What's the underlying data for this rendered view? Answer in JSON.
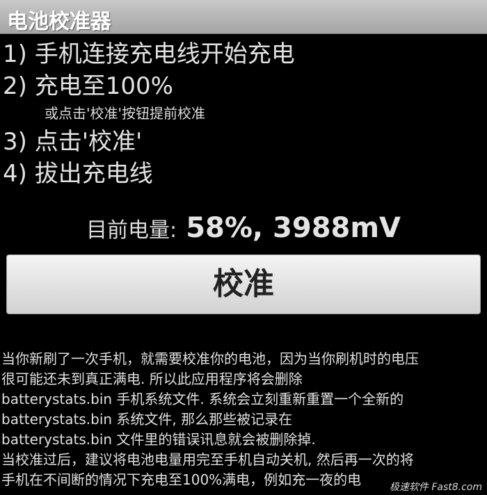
{
  "app": {
    "title": "电池校准器"
  },
  "steps": {
    "step1": "1) 手机连接充电线开始充电",
    "step2": "2) 充电至100%",
    "step2_note": "或点击'校准'按钮提前校准",
    "step3": "3) 点击'校准'",
    "step4": "4) 拔出充电线"
  },
  "battery": {
    "label": "目前电量:",
    "value": "58%, 3988mV"
  },
  "actions": {
    "calibrate_label": "校准"
  },
  "description": {
    "lines": [
      "当你新刷了一次手机，就需要校准你的电池，因为当你刷机时的电压",
      "很可能还未到真正满电. 所以此应用程序将会删除",
      "batterystats.bin 手机系统文件. 系统会立刻重新重置一个全新的",
      "batterystats.bin 系统文件, 那么那些被记录在",
      "batterystats.bin 文件里的错误讯息就会被删除掉.",
      "当校准过后，建议将电池电量用完至手机自动关机, 然后再一次的将",
      "手机在不间断的情况下充电至100%满电，例如充一夜的电"
    ]
  },
  "watermark": {
    "text": "极速软件 Fast8.com"
  },
  "colors": {
    "background": "#000000",
    "titlebar": "#b4b4b4",
    "button": "#e6e6e6",
    "text": "#e2e2e2"
  }
}
